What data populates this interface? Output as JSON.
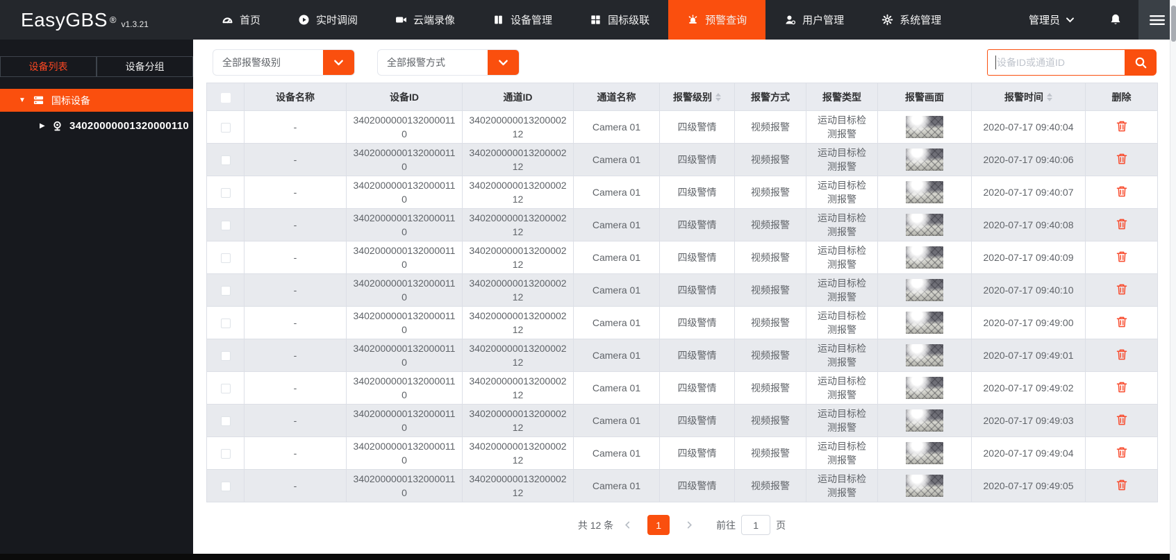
{
  "app": {
    "name": "EasyGBS",
    "reg": "®",
    "version": "v1.3.21"
  },
  "navbar": {
    "items": [
      {
        "label": "首页",
        "icon": "dashboard-icon"
      },
      {
        "label": "实时调阅",
        "icon": "play-circle-icon"
      },
      {
        "label": "云端录像",
        "icon": "video-camera-icon"
      },
      {
        "label": "设备管理",
        "icon": "device-manage-icon"
      },
      {
        "label": "国标级联",
        "icon": "cascade-grid-icon"
      },
      {
        "label": "预警查询",
        "icon": "alarm-siren-icon",
        "active": true
      },
      {
        "label": "用户管理",
        "icon": "user-manage-icon"
      },
      {
        "label": "系统管理",
        "icon": "gear-icon"
      }
    ],
    "admin_label": "管理员"
  },
  "sidebar": {
    "tabs": [
      {
        "label": "设备列表",
        "active": true
      },
      {
        "label": "设备分组",
        "active": false
      }
    ],
    "group_label": "国标设备",
    "device_id": "34020000001320000110"
  },
  "filters": {
    "alarm_level": "全部报警级别",
    "alarm_method": "全部报警方式",
    "search_placeholder": "设备ID或通道ID"
  },
  "table": {
    "columns": [
      "设备名称",
      "设备ID",
      "通道ID",
      "通道名称",
      "报警级别",
      "报警方式",
      "报警类型",
      "报警画面",
      "报警时间",
      "删除"
    ],
    "rows": [
      {
        "device_name": "-",
        "device_id": "34020000001320000110",
        "channel_id": "34020000001320000212",
        "channel_name": "Camera 01",
        "alarm_level": "四级警情",
        "alarm_method": "视频报警",
        "alarm_type": "运动目标检测报警",
        "alarm_time": "2020-07-17 09:40:04"
      },
      {
        "device_name": "-",
        "device_id": "34020000001320000110",
        "channel_id": "34020000001320000212",
        "channel_name": "Camera 01",
        "alarm_level": "四级警情",
        "alarm_method": "视频报警",
        "alarm_type": "运动目标检测报警",
        "alarm_time": "2020-07-17 09:40:06"
      },
      {
        "device_name": "-",
        "device_id": "34020000001320000110",
        "channel_id": "34020000001320000212",
        "channel_name": "Camera 01",
        "alarm_level": "四级警情",
        "alarm_method": "视频报警",
        "alarm_type": "运动目标检测报警",
        "alarm_time": "2020-07-17 09:40:07"
      },
      {
        "device_name": "-",
        "device_id": "34020000001320000110",
        "channel_id": "34020000001320000212",
        "channel_name": "Camera 01",
        "alarm_level": "四级警情",
        "alarm_method": "视频报警",
        "alarm_type": "运动目标检测报警",
        "alarm_time": "2020-07-17 09:40:08"
      },
      {
        "device_name": "-",
        "device_id": "34020000001320000110",
        "channel_id": "34020000001320000212",
        "channel_name": "Camera 01",
        "alarm_level": "四级警情",
        "alarm_method": "视频报警",
        "alarm_type": "运动目标检测报警",
        "alarm_time": "2020-07-17 09:40:09"
      },
      {
        "device_name": "-",
        "device_id": "34020000001320000110",
        "channel_id": "34020000001320000212",
        "channel_name": "Camera 01",
        "alarm_level": "四级警情",
        "alarm_method": "视频报警",
        "alarm_type": "运动目标检测报警",
        "alarm_time": "2020-07-17 09:40:10"
      },
      {
        "device_name": "-",
        "device_id": "34020000001320000110",
        "channel_id": "34020000001320000212",
        "channel_name": "Camera 01",
        "alarm_level": "四级警情",
        "alarm_method": "视频报警",
        "alarm_type": "运动目标检测报警",
        "alarm_time": "2020-07-17 09:49:00"
      },
      {
        "device_name": "-",
        "device_id": "34020000001320000110",
        "channel_id": "34020000001320000212",
        "channel_name": "Camera 01",
        "alarm_level": "四级警情",
        "alarm_method": "视频报警",
        "alarm_type": "运动目标检测报警",
        "alarm_time": "2020-07-17 09:49:01"
      },
      {
        "device_name": "-",
        "device_id": "34020000001320000110",
        "channel_id": "34020000001320000212",
        "channel_name": "Camera 01",
        "alarm_level": "四级警情",
        "alarm_method": "视频报警",
        "alarm_type": "运动目标检测报警",
        "alarm_time": "2020-07-17 09:49:02"
      },
      {
        "device_name": "-",
        "device_id": "34020000001320000110",
        "channel_id": "34020000001320000212",
        "channel_name": "Camera 01",
        "alarm_level": "四级警情",
        "alarm_method": "视频报警",
        "alarm_type": "运动目标检测报警",
        "alarm_time": "2020-07-17 09:49:03"
      },
      {
        "device_name": "-",
        "device_id": "34020000001320000110",
        "channel_id": "34020000001320000212",
        "channel_name": "Camera 01",
        "alarm_level": "四级警情",
        "alarm_method": "视频报警",
        "alarm_type": "运动目标检测报警",
        "alarm_time": "2020-07-17 09:49:04"
      },
      {
        "device_name": "-",
        "device_id": "34020000001320000110",
        "channel_id": "34020000001320000212",
        "channel_name": "Camera 01",
        "alarm_level": "四级警情",
        "alarm_method": "视频报警",
        "alarm_type": "运动目标检测报警",
        "alarm_time": "2020-07-17 09:49:05"
      }
    ]
  },
  "pagination": {
    "total_label": "共 12 条",
    "current_page": "1",
    "goto_prefix": "前往",
    "goto_page": "1",
    "goto_suffix": "页"
  },
  "colors": {
    "accent_orange": "#fa4f0e",
    "navbar_bg": "#24272c",
    "sidebar_bg": "#17191e",
    "table_header_bg": "#e9ebf0",
    "stripe_bg": "#e8eaee",
    "danger_red": "#f84b2d",
    "active_tab_text": "#fc4722"
  }
}
